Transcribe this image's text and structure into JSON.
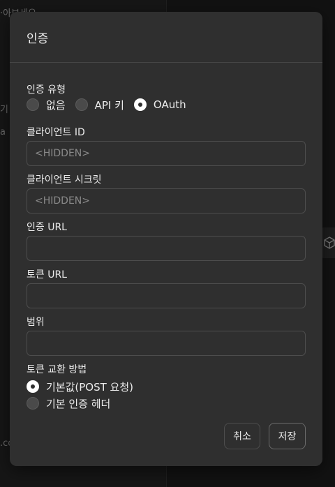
{
  "dialog": {
    "title": "인증",
    "auth_type": {
      "label": "인증 유형",
      "options": [
        {
          "label": "없음",
          "selected": false
        },
        {
          "label": "API 키",
          "selected": false
        },
        {
          "label": "OAuth",
          "selected": true
        }
      ]
    },
    "client_id": {
      "label": "클라이언트 ID",
      "placeholder": "<HIDDEN>"
    },
    "client_secret": {
      "label": "클라이언트 시크릿",
      "placeholder": "<HIDDEN>"
    },
    "auth_url": {
      "label": "인증 URL",
      "placeholder": ""
    },
    "token_url": {
      "label": "토큰 URL",
      "placeholder": ""
    },
    "scope": {
      "label": "범위",
      "placeholder": ""
    },
    "token_exchange": {
      "label": "토큰 교환 방법",
      "options": [
        {
          "label": "기본값(POST 요청)",
          "selected": true
        },
        {
          "label": "기본 인증 헤더",
          "selected": false
        }
      ]
    },
    "buttons": {
      "cancel": "취소",
      "save": "저장"
    }
  },
  "background": {
    "texts": [
      "·아보세요",
      "기",
      "a",
      "",
      ".co"
    ]
  }
}
